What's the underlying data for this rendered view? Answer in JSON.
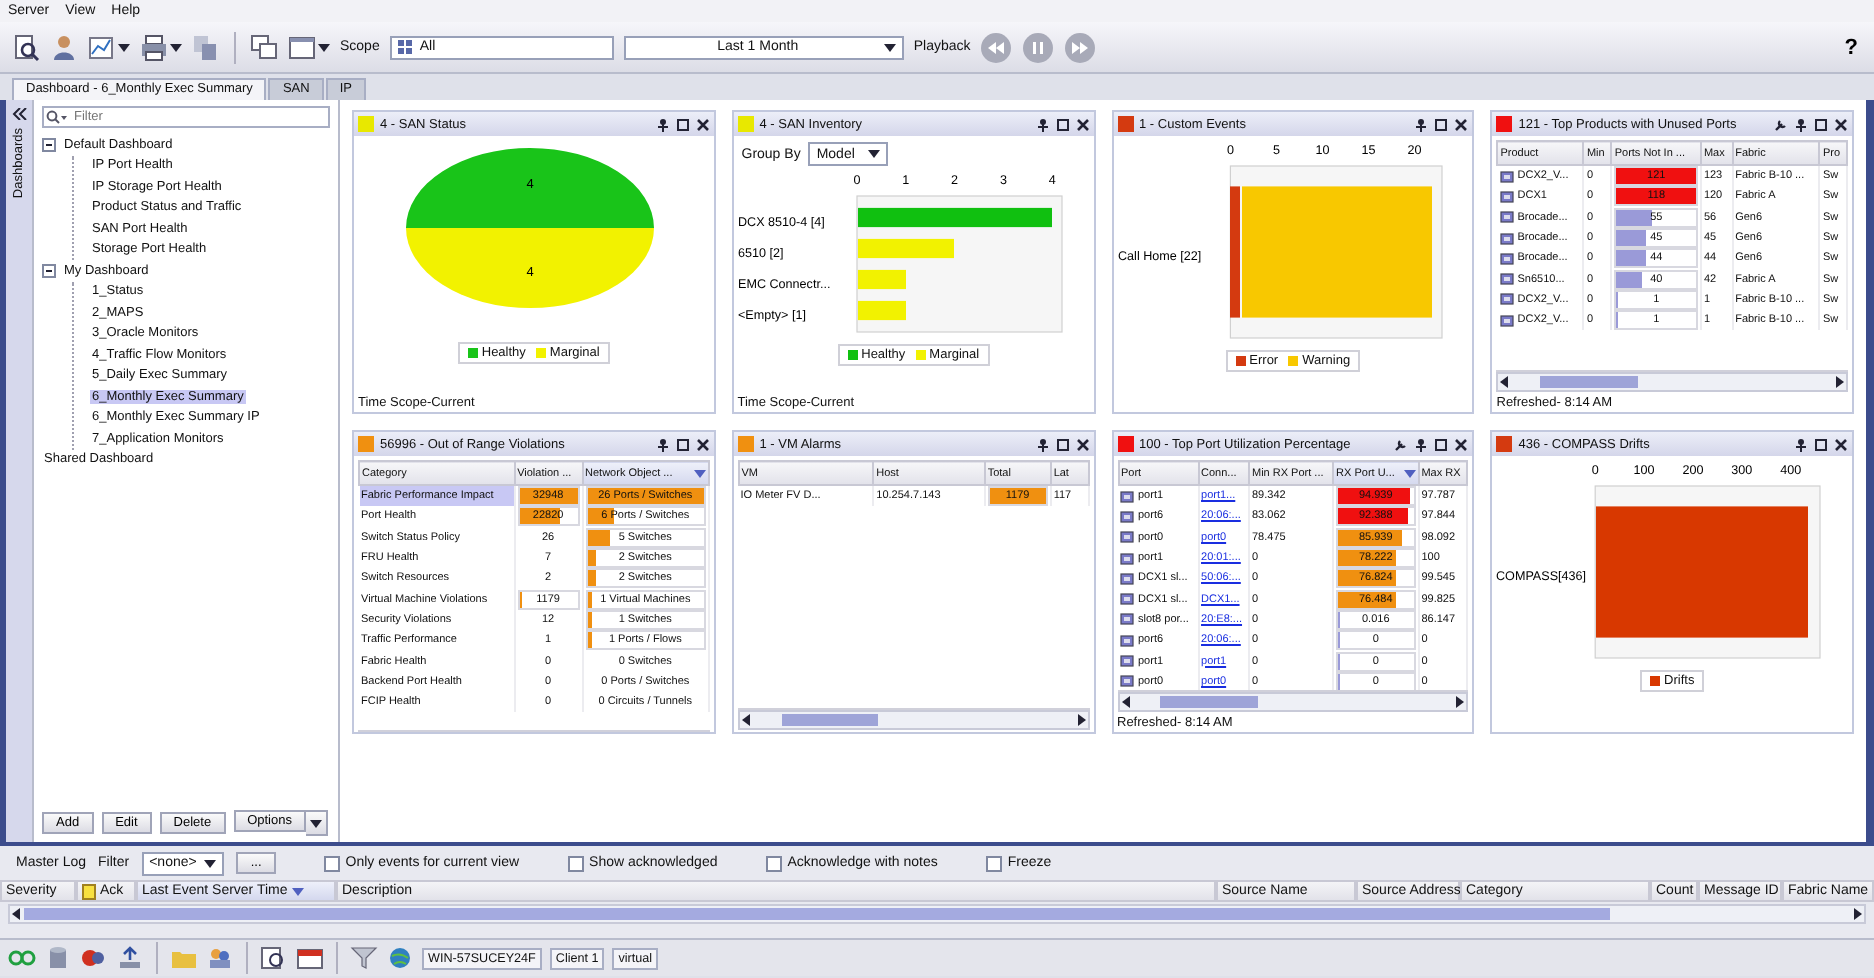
{
  "menu": [
    "Server",
    "View",
    "Help"
  ],
  "toolbar": {
    "scope_label": "Scope",
    "scope": "All",
    "time_range": "Last 1 Month",
    "playback_label": "Playback",
    "help": "?"
  },
  "tabs": [
    {
      "label": "Dashboard - 6_Monthly Exec Summary",
      "selected": true
    },
    {
      "label": "SAN",
      "selected": false
    },
    {
      "label": "IP",
      "selected": false
    }
  ],
  "sidebar": {
    "strip_label": "Dashboards",
    "filter_placeholder": "Filter",
    "tree": [
      {
        "label": "Default Dashboard",
        "expanded": true,
        "selected": false,
        "children": [
          {
            "label": "IP Port Health",
            "selected": false
          },
          {
            "label": "IP Storage Port Health",
            "selected": false
          },
          {
            "label": "Product Status and Traffic",
            "selected": false
          },
          {
            "label": "SAN Port Health",
            "selected": false
          },
          {
            "label": "Storage Port Health",
            "selected": false
          }
        ]
      },
      {
        "label": "My Dashboard",
        "expanded": true,
        "selected": false,
        "children": [
          {
            "label": "1_Status",
            "selected": false
          },
          {
            "label": "2_MAPS",
            "selected": false
          },
          {
            "label": "3_Oracle Monitors",
            "selected": false
          },
          {
            "label": "4_Traffic Flow Monitors",
            "selected": false
          },
          {
            "label": "5_Daily Exec Summary",
            "selected": false
          },
          {
            "label": "6_Monthly Exec Summary",
            "selected": true
          },
          {
            "label": "6_Monthly Exec Summary IP",
            "selected": false
          },
          {
            "label": "7_Application Monitors",
            "selected": false
          }
        ]
      },
      {
        "label": "Shared Dashboard",
        "selected": false
      }
    ],
    "buttons": [
      "Add",
      "Edit",
      "Delete",
      "Options"
    ]
  },
  "widgets": [
    {
      "kind": "pie",
      "title": "4 - SAN Status",
      "color": "#e8e800",
      "footer": "Time Scope-Current",
      "chart_data": {
        "type": "pie",
        "series": [
          {
            "name": "Healthy",
            "color": "#19c419",
            "values": [
              4
            ]
          },
          {
            "name": "Marginal",
            "color": "#f2f200",
            "values": [
              4
            ]
          }
        ],
        "data_labels": true
      }
    },
    {
      "kind": "hbar",
      "title": "4 - SAN Inventory",
      "color": "#e8e800",
      "footer": "Time Scope-Current",
      "group_by": {
        "label": "Group By",
        "value": "Model"
      },
      "chart_data": {
        "type": "bar",
        "orientation": "horizontal",
        "stacked": true,
        "categories": [
          "DCX 8510-4 [4]",
          "6510 [2]",
          "EMC Connectr...",
          "<Empty> [1]"
        ],
        "series": [
          {
            "name": "Healthy",
            "color": "#10c010",
            "values": [
              4,
              0,
              0,
              0
            ]
          },
          {
            "name": "Marginal",
            "color": "#f2f200",
            "values": [
              0,
              2,
              1,
              1
            ]
          }
        ],
        "xlim": [
          0,
          4.2
        ],
        "xticks": [
          0,
          1,
          2,
          3,
          4
        ]
      }
    },
    {
      "kind": "hbar",
      "title": "1 - Custom Events",
      "color": "#d43a10",
      "chart_data": {
        "type": "bar",
        "orientation": "horizontal",
        "stacked": true,
        "categories": [
          "Call Home [22]"
        ],
        "series": [
          {
            "name": "Error",
            "color": "#d43a10",
            "values": [
              1
            ]
          },
          {
            "name": "Warning",
            "color": "#f8c800",
            "values": [
              21
            ]
          }
        ],
        "xlim": [
          0,
          23
        ],
        "xticks": [
          0,
          5,
          10,
          15,
          20
        ]
      }
    },
    {
      "kind": "table",
      "title": "121 - Top Products with Unused Ports",
      "color": "#f01010",
      "wrench": true,
      "footer": "Refreshed- 8:14 AM",
      "horizontal_scrollbar": true,
      "table": {
        "columns": [
          {
            "label": "Product",
            "kind": "device",
            "sorted": false
          },
          {
            "label": "Min",
            "kind": "text",
            "sorted": false
          },
          {
            "label": "Ports Not In ...",
            "kind": "bar",
            "sorted": false
          },
          {
            "label": "Max",
            "kind": "text",
            "sorted": false
          },
          {
            "label": "Fabric",
            "kind": "text",
            "sorted": false
          },
          {
            "label": "Pro",
            "kind": "text",
            "sorted": false
          }
        ],
        "rows": [
          {
            "selected": false,
            "cells": [
              "DCX2_V...",
              "0",
              {
                "text": "121",
                "level": 1,
                "color": "#f01010"
              },
              "123",
              "Fabric B-10 ...",
              "Sw"
            ]
          },
          {
            "selected": false,
            "cells": [
              "DCX1",
              "0",
              {
                "text": "118",
                "level": 1,
                "color": "#f01010"
              },
              "120",
              "Fabric A",
              "Sw"
            ]
          },
          {
            "selected": false,
            "cells": [
              "Brocade...",
              "0",
              {
                "text": "55",
                "level": 0.45,
                "color": "#9a9ad8"
              },
              "56",
              "Gen6",
              "Sw"
            ]
          },
          {
            "selected": false,
            "cells": [
              "Brocade...",
              "0",
              {
                "text": "45",
                "level": 0.37,
                "color": "#9a9ad8"
              },
              "45",
              "Gen6",
              "Sw"
            ]
          },
          {
            "selected": false,
            "cells": [
              "Brocade...",
              "0",
              {
                "text": "44",
                "level": 0.36,
                "color": "#9a9ad8"
              },
              "44",
              "Gen6",
              "Sw"
            ]
          },
          {
            "selected": false,
            "cells": [
              "Sn6510...",
              "0",
              {
                "text": "40",
                "level": 0.33,
                "color": "#9a9ad8"
              },
              "42",
              "Fabric A",
              "Sw"
            ]
          },
          {
            "selected": false,
            "cells": [
              "DCX2_V...",
              "0",
              {
                "text": "1",
                "level": 0.02,
                "color": "#9a9ad8"
              },
              "1",
              "Fabric B-10 ...",
              "Sw"
            ]
          },
          {
            "selected": false,
            "cells": [
              "DCX2_V...",
              "0",
              {
                "text": "1",
                "level": 0.02,
                "color": "#9a9ad8"
              },
              "1",
              "Fabric B-10 ...",
              "Sw"
            ]
          }
        ]
      }
    },
    {
      "kind": "table",
      "title": "56996 - Out of Range Violations",
      "color": "#f09010",
      "table": {
        "columns": [
          {
            "label": "Category",
            "kind": "text",
            "sorted": false
          },
          {
            "label": "Violation ...",
            "kind": "bar",
            "sorted": false
          },
          {
            "label": "Network Object ...",
            "kind": "bar",
            "sorted": true
          }
        ],
        "rows": [
          {
            "selected": true,
            "cells": [
              "Fabric Performance Impact",
              {
                "text": "32948",
                "level": 1,
                "color": "#f09010"
              },
              {
                "text": "26 Ports / Switches",
                "level": 1,
                "color": "#f09010"
              }
            ]
          },
          {
            "selected": false,
            "cells": [
              "Port Health",
              {
                "text": "22820",
                "level": 0.7,
                "color": "#f09010"
              },
              {
                "text": "6 Ports / Switches",
                "level": 0.23,
                "color": "#f09010"
              }
            ]
          },
          {
            "selected": false,
            "cells": [
              "Switch Status Policy",
              "26",
              {
                "text": "5 Switches",
                "level": 0.19,
                "color": "#f09010"
              }
            ]
          },
          {
            "selected": false,
            "cells": [
              "FRU Health",
              "7",
              {
                "text": "2 Switches",
                "level": 0.08,
                "color": "#f09010"
              }
            ]
          },
          {
            "selected": false,
            "cells": [
              "Switch Resources",
              "2",
              {
                "text": "2 Switches",
                "level": 0.08,
                "color": "#f09010"
              }
            ]
          },
          {
            "selected": false,
            "cells": [
              "Virtual Machine Violations",
              {
                "text": "1179",
                "level": 0.04,
                "color": "#f09010"
              },
              {
                "text": "1 Virtual Machines",
                "level": 0.04,
                "color": "#f09010"
              }
            ]
          },
          {
            "selected": false,
            "cells": [
              "Security Violations",
              "12",
              {
                "text": "1 Switches",
                "level": 0.04,
                "color": "#f09010"
              }
            ]
          },
          {
            "selected": false,
            "cells": [
              "Traffic Performance",
              "1",
              {
                "text": "1 Ports / Flows",
                "level": 0.04,
                "color": "#f09010"
              }
            ]
          },
          {
            "selected": false,
            "cells": [
              "Fabric Health",
              "0",
              "0 Switches"
            ]
          },
          {
            "selected": false,
            "cells": [
              "Backend Port Health",
              "0",
              "0 Ports / Switches"
            ]
          },
          {
            "selected": false,
            "cells": [
              "FCIP Health",
              "0",
              "0 Circuits / Tunnels"
            ]
          }
        ]
      }
    },
    {
      "kind": "table",
      "title": "1 - VM Alarms",
      "color": "#f09010",
      "horizontal_scrollbar": true,
      "table": {
        "columns": [
          {
            "label": "VM",
            "kind": "text",
            "sorted": false
          },
          {
            "label": "Host",
            "kind": "text",
            "sorted": false
          },
          {
            "label": "Total",
            "kind": "bar",
            "sorted": false
          },
          {
            "label": "Lat",
            "kind": "text",
            "sorted": false
          }
        ],
        "rows": [
          {
            "selected": false,
            "cells": [
              "IO Meter FV D...",
              "10.254.7.143",
              {
                "text": "1179",
                "level": 1,
                "color": "#f09010"
              },
              "117"
            ]
          }
        ]
      }
    },
    {
      "kind": "table",
      "title": "100 - Top Port Utilization Percentage",
      "color": "#f01010",
      "wrench": true,
      "footer": "Refreshed- 8:14 AM",
      "horizontal_scrollbar": true,
      "table": {
        "columns": [
          {
            "label": "Port",
            "kind": "device",
            "sorted": false
          },
          {
            "label": "Conn...",
            "kind": "link",
            "sorted": false
          },
          {
            "label": "Min RX Port ...",
            "kind": "text",
            "sorted": false
          },
          {
            "label": "RX Port U...",
            "kind": "bar",
            "sorted": true
          },
          {
            "label": "Max RX",
            "kind": "text",
            "sorted": false
          }
        ],
        "rows": [
          {
            "selected": false,
            "cells": [
              "port1",
              "port1...",
              "89.342",
              {
                "text": "94.939",
                "level": 0.95,
                "color": "#f01010"
              },
              "97.787"
            ]
          },
          {
            "selected": false,
            "cells": [
              "port6",
              "20:06:...",
              "83.062",
              {
                "text": "92.388",
                "level": 0.92,
                "color": "#f01010"
              },
              "97.844"
            ]
          },
          {
            "selected": false,
            "cells": [
              "port0",
              "port0",
              "78.475",
              {
                "text": "85.939",
                "level": 0.86,
                "color": "#f09010"
              },
              "98.092"
            ]
          },
          {
            "selected": false,
            "cells": [
              "port1",
              "20:01:...",
              "0",
              {
                "text": "78.222",
                "level": 0.78,
                "color": "#f09010"
              },
              "100"
            ]
          },
          {
            "selected": false,
            "cells": [
              "DCX1 sl...",
              "50:06:...",
              "0",
              {
                "text": "76.824",
                "level": 0.77,
                "color": "#f09010"
              },
              "99.545"
            ]
          },
          {
            "selected": false,
            "cells": [
              "DCX1 sl...",
              "DCX1...",
              "0",
              {
                "text": "76.484",
                "level": 0.76,
                "color": "#f09010"
              },
              "99.825"
            ]
          },
          {
            "selected": false,
            "cells": [
              "slot8 por...",
              "20:E8:...",
              "0",
              {
                "text": "0.016",
                "level": 0.01,
                "color": "#9a9ad8"
              },
              "86.147"
            ]
          },
          {
            "selected": false,
            "cells": [
              "port6",
              "20:06:...",
              "0",
              {
                "text": "0",
                "level": 0.01,
                "color": "#9a9ad8"
              },
              "0"
            ]
          },
          {
            "selected": false,
            "cells": [
              "port1",
              "port1",
              "0",
              {
                "text": "0",
                "level": 0.01,
                "color": "#9a9ad8"
              },
              "0"
            ]
          },
          {
            "selected": false,
            "cells": [
              "port0",
              "port0",
              "0",
              {
                "text": "0",
                "level": 0.01,
                "color": "#9a9ad8"
              },
              "0"
            ]
          }
        ]
      }
    },
    {
      "kind": "hbar",
      "title": "436 - COMPASS Drifts",
      "color": "#d43a10",
      "chart_data": {
        "type": "bar",
        "orientation": "horizontal",
        "categories": [
          "COMPASS[436]"
        ],
        "series": [
          {
            "name": "Drifts",
            "color": "#d83800",
            "values": [
              436
            ]
          }
        ],
        "xlim": [
          0,
          460
        ],
        "xticks": [
          0,
          100,
          200,
          300,
          400
        ]
      }
    }
  ],
  "master_log": {
    "title": "Master Log",
    "filter_label": "Filter",
    "filter_value": "<none>",
    "more": "...",
    "options": [
      {
        "label": "Only events for current view",
        "checked": false
      },
      {
        "label": "Show acknowledged",
        "checked": false
      },
      {
        "label": "Acknowledge with notes",
        "checked": false
      },
      {
        "label": "Freeze",
        "checked": false
      }
    ],
    "columns": [
      {
        "label": "Severity",
        "sorted": false
      },
      {
        "label": "Ack",
        "sorted": false
      },
      {
        "label": "Last Event Server Time",
        "sorted": true
      },
      {
        "label": "Description",
        "sorted": false
      },
      {
        "label": "Source Name",
        "sorted": false
      },
      {
        "label": "Source Address",
        "sorted": false
      },
      {
        "label": "Category",
        "sorted": false
      },
      {
        "label": "Count",
        "sorted": false
      },
      {
        "label": "Message ID",
        "sorted": false
      },
      {
        "label": "Fabric Name",
        "sorted": false
      }
    ]
  },
  "status_bar": {
    "host": "WIN-57SUCEY24F",
    "client": "Client 1",
    "mode": "virtual"
  }
}
